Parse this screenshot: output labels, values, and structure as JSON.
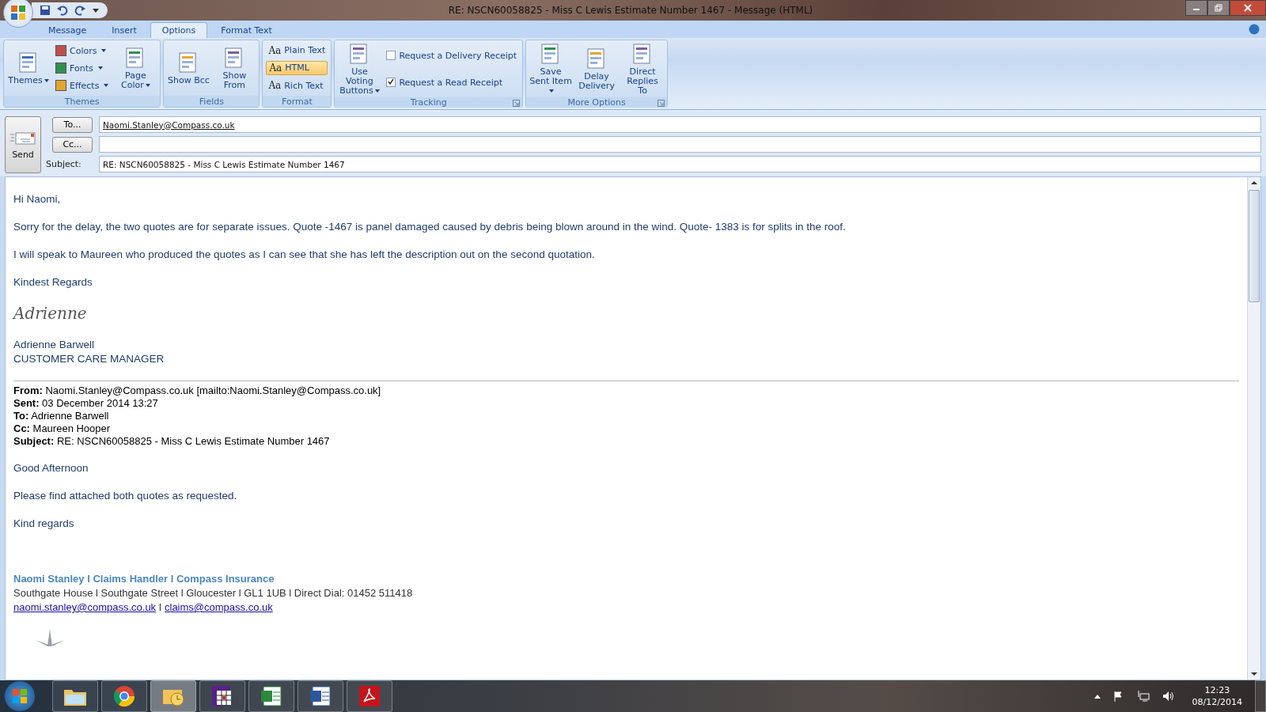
{
  "window": {
    "title": "RE: NSCN60058825 - Miss C Lewis Estimate Number 1467  -  Message (HTML)"
  },
  "tabs": [
    {
      "label": "Message",
      "selected": false
    },
    {
      "label": "Insert",
      "selected": false
    },
    {
      "label": "Options",
      "selected": true
    },
    {
      "label": "Format Text",
      "selected": false
    }
  ],
  "ribbon": [
    {
      "label": "Themes",
      "launcher": false,
      "columns": [
        [
          {
            "kind": "large",
            "label": "Themes",
            "dropdown": true
          }
        ],
        [
          {
            "kind": "small",
            "label": "Colors",
            "dropdown": true
          },
          {
            "kind": "small",
            "label": "Fonts",
            "dropdown": true
          },
          {
            "kind": "small",
            "label": "Effects",
            "dropdown": true
          }
        ],
        [
          {
            "kind": "large",
            "label": "Page Color",
            "dropdown": true
          }
        ]
      ]
    },
    {
      "label": "Fields",
      "launcher": false,
      "columns": [
        [
          {
            "kind": "large",
            "label": "Show Bcc",
            "dropdown": false
          }
        ],
        [
          {
            "kind": "large",
            "label": "Show From",
            "dropdown": false
          }
        ]
      ]
    },
    {
      "label": "Format",
      "launcher": false,
      "columns": [
        [
          {
            "kind": "format",
            "glyph": "Aa",
            "label": "Plain Text",
            "selected": false
          },
          {
            "kind": "format",
            "glyph": "Aa",
            "label": "HTML",
            "selected": true
          },
          {
            "kind": "format",
            "glyph": "Aa",
            "label": "Rich Text",
            "selected": false
          }
        ]
      ]
    },
    {
      "label": "Tracking",
      "launcher": true,
      "columns": [
        [
          {
            "kind": "large",
            "label": "Use Voting Buttons",
            "dropdown": true
          }
        ],
        [
          {
            "kind": "checkbox",
            "label": "Request a Delivery Receipt",
            "checked": false
          },
          {
            "kind": "checkbox",
            "label": "Request a Read Receipt",
            "checked": true
          }
        ]
      ]
    },
    {
      "label": "More Options",
      "launcher": true,
      "columns": [
        [
          {
            "kind": "large",
            "label": "Save Sent Item",
            "dropdown": true
          }
        ],
        [
          {
            "kind": "large",
            "label": "Delay Delivery",
            "dropdown": false
          }
        ],
        [
          {
            "kind": "large",
            "label": "Direct Replies To",
            "dropdown": false
          }
        ]
      ]
    }
  ],
  "compose": {
    "send": "Send",
    "to_button": "To...",
    "cc_button": "Cc...",
    "subject_label": "Subject:",
    "to": "Naomi.Stanley@Compass.co.uk",
    "subject": "RE: NSCN60058825 - Miss C Lewis Estimate Number 1467"
  },
  "body": [
    {
      "kind": "text",
      "text": "Hi Naomi,"
    },
    {
      "kind": "text",
      "text": "Sorry for the delay, the two quotes are for separate issues.  Quote -1467 is panel damaged caused by debris being blown around in the wind.  Quote- 1383 is for splits in the roof."
    },
    {
      "kind": "text",
      "text": "I will speak to Maureen who produced the quotes as I can see that she has left the description out on the second quotation."
    },
    {
      "kind": "text",
      "text": "Kindest Regards"
    },
    {
      "kind": "script",
      "text": "Adrienne"
    },
    {
      "kind": "line",
      "text": "Adrienne Barwell"
    },
    {
      "kind": "text",
      "text": "CUSTOMER CARE MANAGER"
    },
    {
      "kind": "rule"
    },
    {
      "kind": "header",
      "label": "From:",
      "text": "Naomi.Stanley@Compass.co.uk [mailto:Naomi.Stanley@Compass.co.uk]"
    },
    {
      "kind": "header",
      "label": "Sent:",
      "text": "03 December 2014 13:27"
    },
    {
      "kind": "header",
      "label": "To:",
      "text": "Adrienne Barwell"
    },
    {
      "kind": "header",
      "label": "Cc:",
      "text": "Maureen Hooper"
    },
    {
      "kind": "header_last",
      "label": "Subject:",
      "text": "RE: NSCN60058825 - Miss C Lewis Estimate Number 1467"
    },
    {
      "kind": "text",
      "text": "Good Afternoon"
    },
    {
      "kind": "text",
      "text": "Please find attached both quotes as requested."
    },
    {
      "kind": "text",
      "text": "Kind regards"
    },
    {
      "kind": "spacer"
    },
    {
      "kind": "sig_name",
      "text": "Naomi Stanley l Claims Handler l Compass Insurance"
    },
    {
      "kind": "sig_line",
      "text": "Southgate House l Southgate Street l Gloucester l GL1 1UB l Direct Dial: 01452 511418"
    },
    {
      "kind": "links",
      "links": [
        "naomi.stanley@compass.co.uk",
        "claims@compass.co.uk"
      ],
      "separator": "l"
    },
    {
      "kind": "logo"
    }
  ],
  "taskbar": {
    "apps": [
      {
        "kind": "folder",
        "selected": false
      },
      {
        "kind": "browser",
        "selected": false
      },
      {
        "kind": "mail",
        "selected": true
      },
      {
        "kind": "grid",
        "selected": false
      },
      {
        "kind": "spreadsheet",
        "selected": false
      },
      {
        "kind": "word",
        "selected": false
      },
      {
        "kind": "pdf",
        "selected": false
      }
    ],
    "time": "12:23",
    "date": "08/12/2014"
  }
}
